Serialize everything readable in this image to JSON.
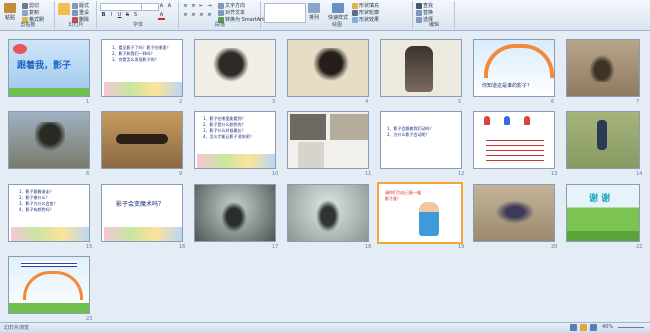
{
  "ribbon": {
    "groups": [
      {
        "label": "剪贴板",
        "buttons": [
          "粘贴",
          "剪切",
          "复制",
          "格式刷"
        ]
      },
      {
        "label": "幻灯片",
        "buttons": [
          "新建幻灯片",
          "版式",
          "重设",
          "删除"
        ]
      },
      {
        "label": "字体",
        "buttons": []
      },
      {
        "label": "段落",
        "buttons": [
          "文字方向",
          "对齐文本",
          "转换为 SmartArt"
        ]
      },
      {
        "label": "绘图",
        "buttons": [
          "排列",
          "快速样式",
          "形状填充",
          "形状轮廓",
          "形状效果"
        ]
      },
      {
        "label": "编辑",
        "buttons": [
          "查找",
          "替换",
          "选择"
        ]
      }
    ]
  },
  "slides": [
    {
      "n": "1",
      "title": "跟着我，影子"
    },
    {
      "n": "2",
      "lines": [
        "1、看见影子了吗？影子在哪里？",
        "2、影子和我们一样吗？",
        "3、你是怎么发现影子的？"
      ]
    },
    {
      "n": "3"
    },
    {
      "n": "4"
    },
    {
      "n": "5"
    },
    {
      "n": "6",
      "caption": "你知道这是谁的影子？"
    },
    {
      "n": "7"
    },
    {
      "n": "8"
    },
    {
      "n": "9"
    },
    {
      "n": "10",
      "lines": [
        "1、影子在哪里能看到？",
        "2、影子是什么颜色的？",
        "3、影子什么时候最长？",
        "4、怎么才能让影子消失呢？"
      ]
    },
    {
      "n": "11"
    },
    {
      "n": "12",
      "lines": [
        "1、影子会跟着我们动吗？",
        "2、为什么影子会动呢？"
      ]
    },
    {
      "n": "13"
    },
    {
      "n": "14"
    },
    {
      "n": "15",
      "lines": [
        "1、影子跟着谁走？",
        "2、影子像什么？",
        "3、影子为什么会变？",
        "4、影子有颜色吗？"
      ]
    },
    {
      "n": "16",
      "title": "影子会变魔术吗？"
    },
    {
      "n": "17"
    },
    {
      "n": "18"
    },
    {
      "n": "19",
      "lines": [
        "请你们为自己画一幅",
        "影子画！"
      ]
    },
    {
      "n": "20"
    },
    {
      "n": "21"
    },
    {
      "n": "22",
      "title": "谢 谢"
    },
    {
      "n": "23"
    }
  ],
  "status": {
    "left": "幻灯片浏览",
    "zoom": "40%"
  }
}
